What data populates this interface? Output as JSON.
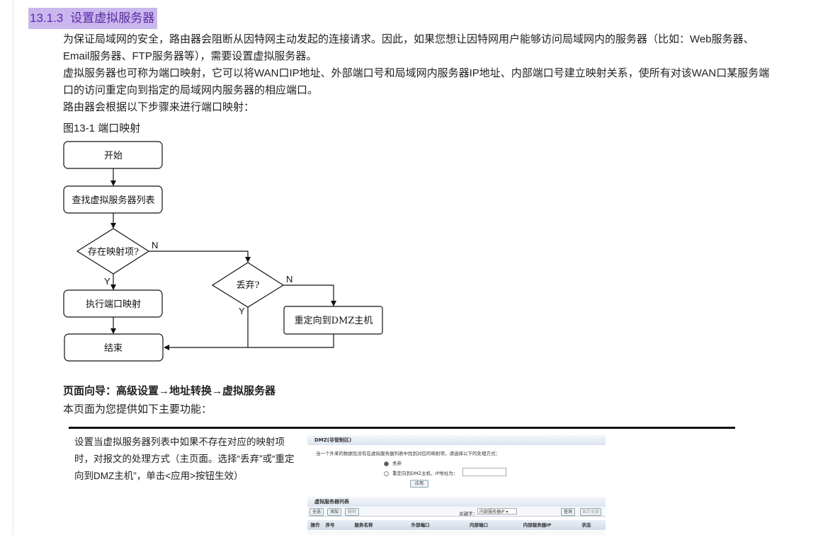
{
  "section": {
    "number": "13.1.3",
    "title": "设置虚拟服务器"
  },
  "paragraphs": [
    "为保证局域网的安全，路由器会阻断从因特网主动发起的连接请求。因此，如果您想让因特网用户能够访问局域网内的服务器（比如：Web服务器、Email服务器、FTP服务器等），需要设置虚拟服务器。",
    "虚拟服务器也可称为端口映射，它可以将WAN口IP地址、外部端口号和局域网内服务器IP地址、内部端口号建立映射关系，使所有对该WAN口某服务端口的访问重定向到指定的局域网内服务器的相应端口。",
    "路由器会根据以下步骤来进行端口映射："
  ],
  "figure_caption": "图13-1 端口映射",
  "flowchart": {
    "start": "开始",
    "lookup": "查找虚拟服务器列表",
    "exists": "存在映射项?",
    "map": "执行端口映射",
    "discard": "丢弃?",
    "dmz": "重定向到DMZ主机",
    "end": "结束",
    "yes": "Y",
    "no": "N"
  },
  "page_nav": "页面向导：高级设置→地址转换→虚拟服务器",
  "intro": "本页面为您提供如下主要功能：",
  "feature_desc": "设置当虚拟服务器列表中如果不存在对应的映射项时，对报文的处理方式（主页面。选择“丢弃”或“重定向到DMZ主机”，单击<应用>按钮生效）",
  "screenshot": {
    "dmz_title": "DMZ(非管制区)",
    "dmz_note": "当一个外来的数据包没有在虚拟服务器列表中找到对应的映射项，请选择以下的处理方式：",
    "option_discard": "丢弃",
    "option_redirect": "重定向到DMZ主机，IP地址为：",
    "apply": "应用",
    "list_title": "虚拟服务器列表",
    "btn_all": "全选",
    "btn_add": "添加",
    "btn_delete": "删除",
    "search_label": "关键字：",
    "search_select": "内部服务器IP",
    "btn_search": "查询",
    "btn_show_all": "显示全部",
    "columns": [
      "操作",
      "序号",
      "服务名称",
      "外部端口",
      "内部端口",
      "内部服务器IP",
      "状态"
    ]
  },
  "colors": {
    "heading_bg": "#c9b7ee",
    "heading_text": "#5b2aa8"
  }
}
